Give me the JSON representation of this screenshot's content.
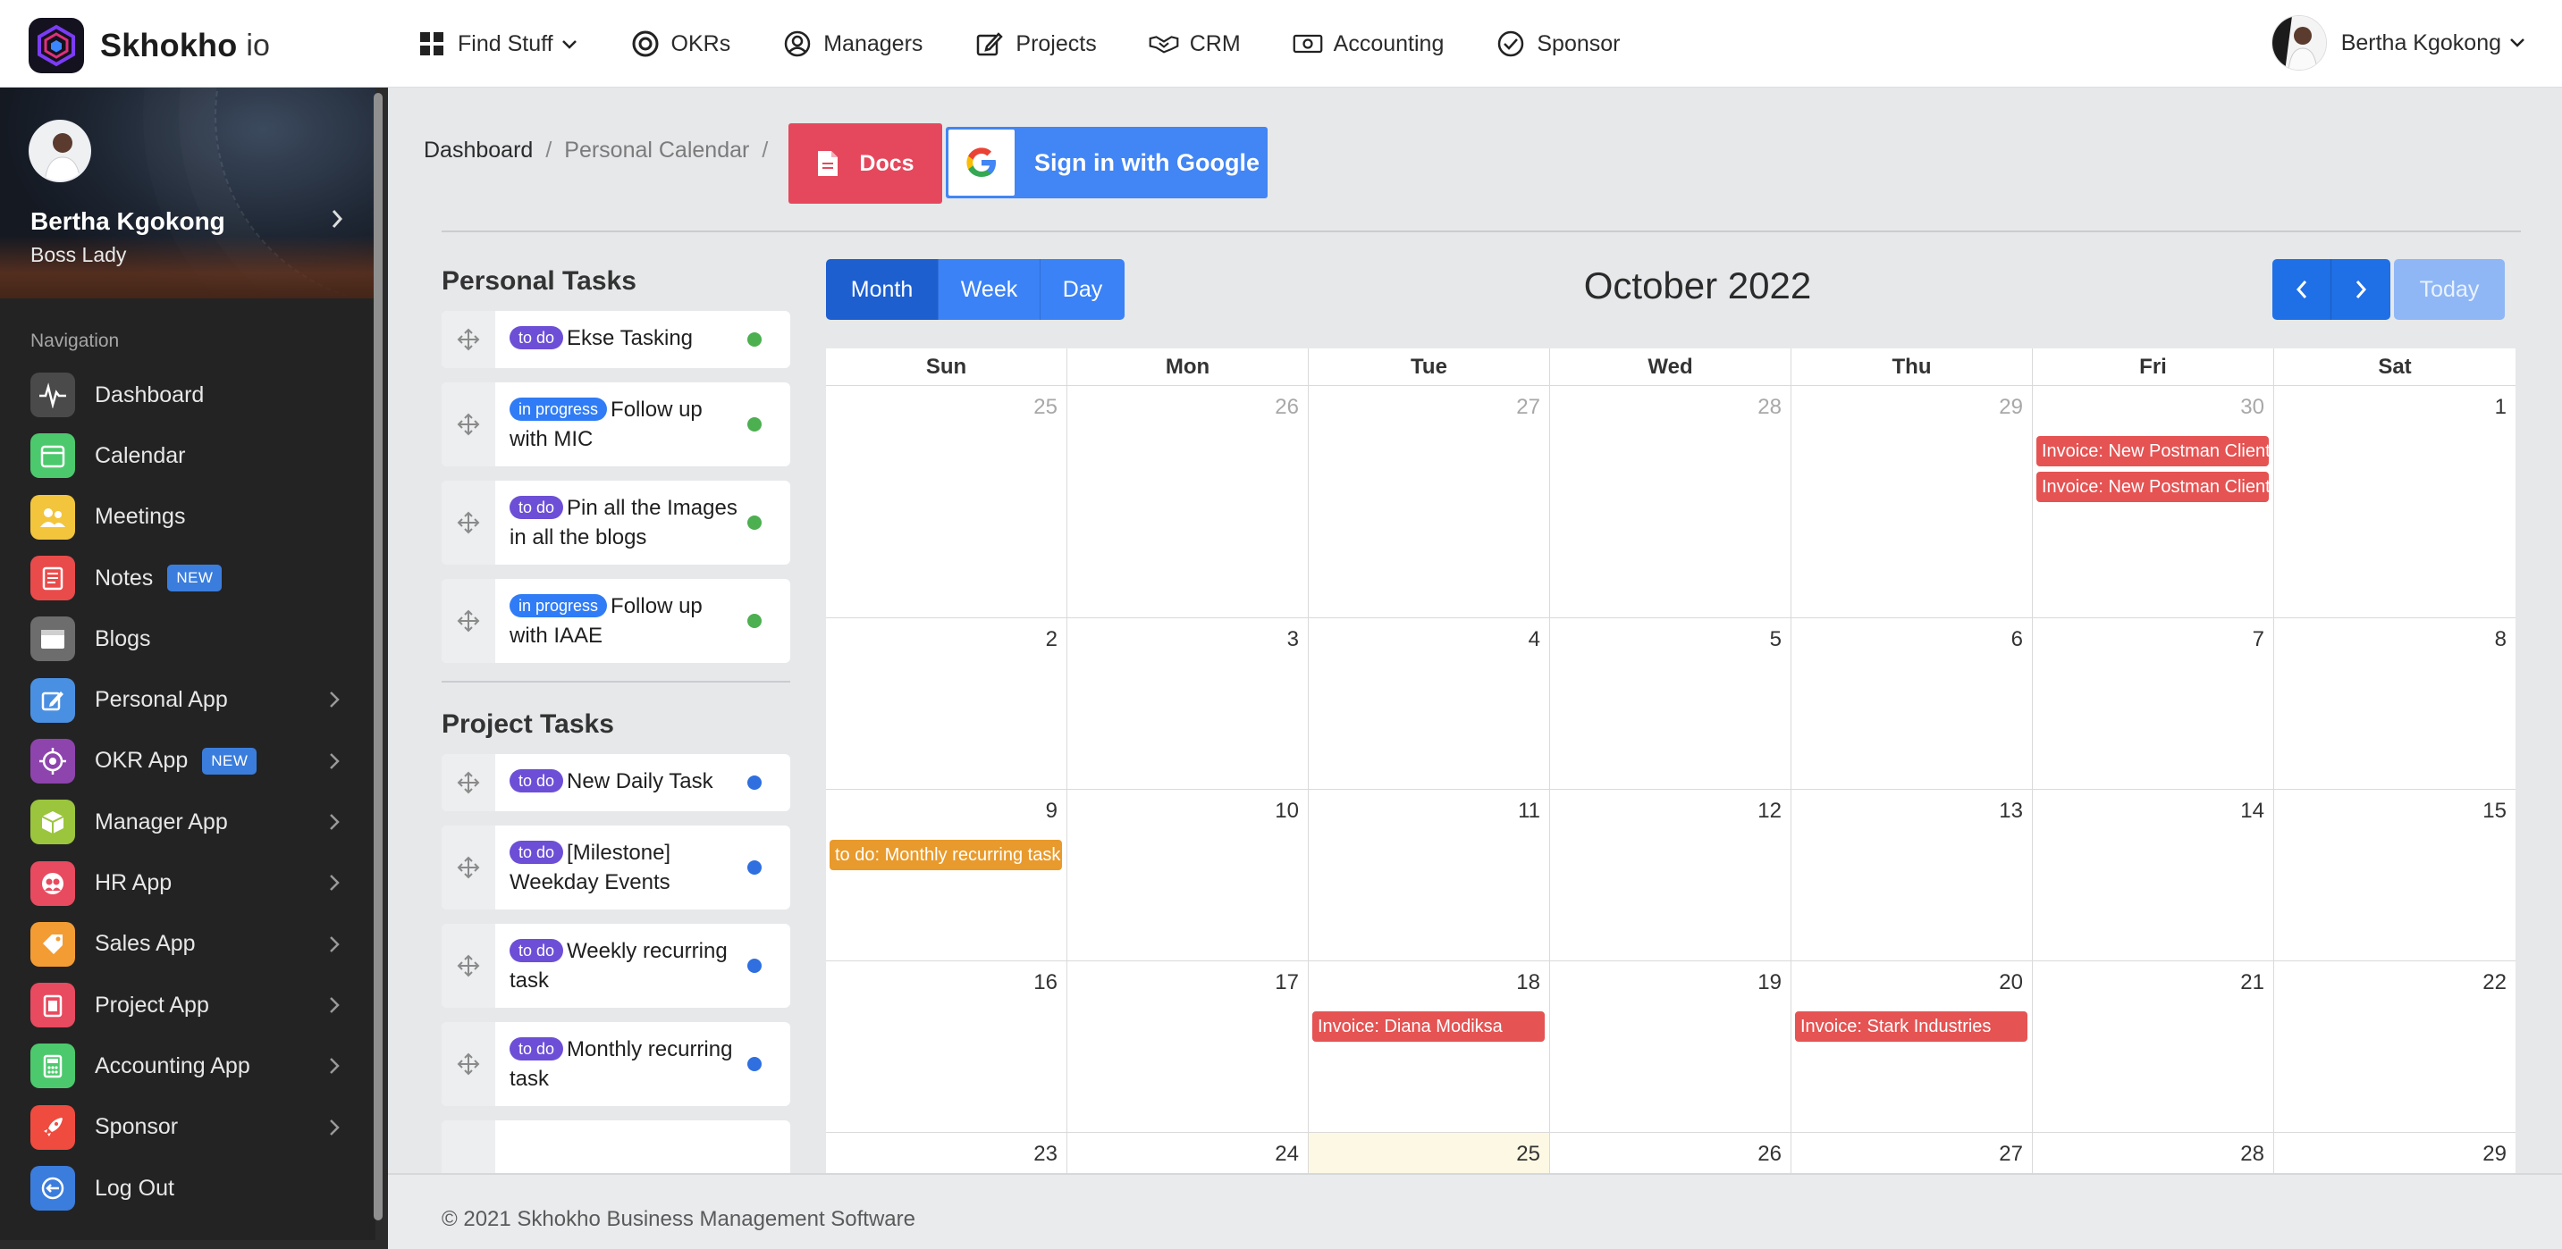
{
  "brand": {
    "name": "Skhokho",
    "suffix": "io"
  },
  "topnav": {
    "items": [
      {
        "label": "Find Stuff",
        "icon": "grid-icon",
        "dropdown": true
      },
      {
        "label": "OKRs",
        "icon": "target-icon"
      },
      {
        "label": "Managers",
        "icon": "user-circle-icon"
      },
      {
        "label": "Projects",
        "icon": "edit-icon"
      },
      {
        "label": "CRM",
        "icon": "handshake-icon"
      },
      {
        "label": "Accounting",
        "icon": "money-icon"
      },
      {
        "label": "Sponsor",
        "icon": "check-circle-icon"
      }
    ],
    "user_name": "Bertha Kgokong"
  },
  "sidebar": {
    "user_name": "Bertha Kgokong",
    "user_role": "Boss Lady",
    "nav_title": "Navigation",
    "items": [
      {
        "label": "Dashboard",
        "icon": "pulse-icon",
        "color": "#4a4a4a"
      },
      {
        "label": "Calendar",
        "icon": "calendar-icon",
        "color": "#4cc96d"
      },
      {
        "label": "Meetings",
        "icon": "people-icon",
        "color": "#f2c53d"
      },
      {
        "label": "Notes",
        "icon": "newspaper-icon",
        "color": "#e94b4b",
        "badge": "NEW"
      },
      {
        "label": "Blogs",
        "icon": "browser-icon",
        "color": "#6d6d6d"
      },
      {
        "label": "Personal App",
        "icon": "pen-square-icon",
        "color": "#4a90e2",
        "chevron": true
      },
      {
        "label": "OKR App",
        "icon": "crosshair-icon",
        "color": "#8e44ad",
        "badge": "NEW",
        "chevron": true
      },
      {
        "label": "Manager App",
        "icon": "cube-icon",
        "color": "#9bc53d",
        "chevron": true
      },
      {
        "label": "HR App",
        "icon": "users-icon",
        "color": "#e84a5f",
        "chevron": true
      },
      {
        "label": "Sales App",
        "icon": "tag-icon",
        "color": "#f39c34",
        "chevron": true
      },
      {
        "label": "Project App",
        "icon": "clipboard-icon",
        "color": "#e84a5f",
        "chevron": true
      },
      {
        "label": "Accounting App",
        "icon": "calculator-icon",
        "color": "#4cc96d",
        "chevron": true
      },
      {
        "label": "Sponsor",
        "icon": "rocket-icon",
        "color": "#ef4b3f",
        "chevron": true
      },
      {
        "label": "Log Out",
        "icon": "logout-icon",
        "color": "#3b7ddd"
      }
    ]
  },
  "breadcrumb": {
    "items": [
      "Dashboard",
      "Personal Calendar"
    ],
    "separator": "/"
  },
  "buttons": {
    "docs": "Docs",
    "google": "Sign in with Google"
  },
  "personal_tasks": {
    "heading": "Personal Tasks",
    "items": [
      {
        "status": "to do",
        "text": "Ekse Tasking"
      },
      {
        "status": "in progress",
        "text": "Follow up with MIC"
      },
      {
        "status": "to do",
        "text": "Pin all the Images in all the blogs"
      },
      {
        "status": "in progress",
        "text": "Follow up with IAAE"
      }
    ]
  },
  "project_tasks": {
    "heading": "Project Tasks",
    "items": [
      {
        "status": "to do",
        "text": "New Daily Task"
      },
      {
        "status": "to do",
        "text": "[Milestone] Weekday Events"
      },
      {
        "status": "to do",
        "text": "Weekly recurring task"
      },
      {
        "status": "to do",
        "text": "Monthly recurring task"
      }
    ]
  },
  "calendar": {
    "views": [
      "Month",
      "Week",
      "Day"
    ],
    "active_view": "Month",
    "title": "October 2022",
    "today_label": "Today",
    "weekdays": [
      "Sun",
      "Mon",
      "Tue",
      "Wed",
      "Thu",
      "Fri",
      "Sat"
    ],
    "weeks": [
      [
        "25",
        "26",
        "27",
        "28",
        "29",
        "30",
        "1"
      ],
      [
        "2",
        "3",
        "4",
        "5",
        "6",
        "7",
        "8"
      ],
      [
        "9",
        "10",
        "11",
        "12",
        "13",
        "14",
        "15"
      ],
      [
        "16",
        "17",
        "18",
        "19",
        "20",
        "21",
        "22"
      ],
      [
        "23",
        "24",
        "25",
        "26",
        "27",
        "28",
        "29"
      ]
    ],
    "events": {
      "w0_fri_1": "Invoice: New Postman Client",
      "w0_fri_2": "Invoice: New Postman Client",
      "w2_sun_1": "to do: Monthly recurring task",
      "w3_tue_1": "Invoice: Diana Modiksa",
      "w3_thu_1": "Invoice: Stark Industries"
    }
  },
  "footer": {
    "text": "© 2021 Skhokho Business Management Software"
  }
}
